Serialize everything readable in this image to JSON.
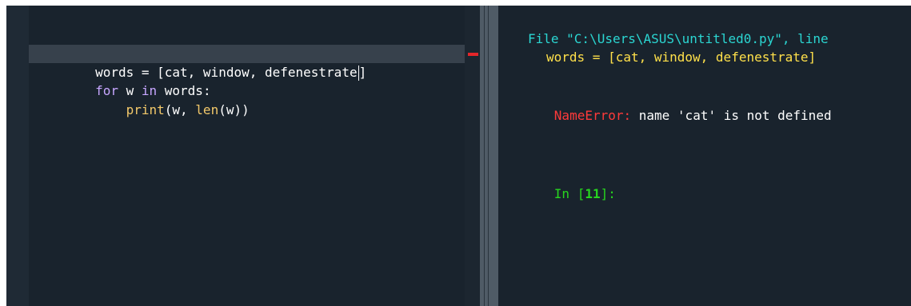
{
  "editor": {
    "lines": [
      {
        "tokens": [
          {
            "text": "words = [cat, window, defenestrate",
            "kind": "plain"
          },
          {
            "text": "]",
            "kind": "plain"
          }
        ]
      },
      {
        "tokens": [
          {
            "text": "for",
            "kind": "keyword"
          },
          {
            "text": " w ",
            "kind": "plain"
          },
          {
            "text": "in",
            "kind": "keyword"
          },
          {
            "text": " words:",
            "kind": "plain"
          }
        ]
      },
      {
        "tokens": [
          {
            "text": "    ",
            "kind": "plain"
          },
          {
            "text": "print",
            "kind": "builtin"
          },
          {
            "text": "(w, ",
            "kind": "plain"
          },
          {
            "text": "len",
            "kind": "builtin"
          },
          {
            "text": "(w))",
            "kind": "plain"
          }
        ]
      }
    ]
  },
  "console": {
    "traceback_file": "File \"C:\\Users\\ASUS\\untitled0.py\", line",
    "traceback_code": "words = [cat, window, defenestrate]",
    "error_name": "NameError:",
    "error_message": " name 'cat' is not defined",
    "prompt_prefix": "In [",
    "prompt_number": "11",
    "prompt_suffix": "]:"
  },
  "colors": {
    "editor_bg": "#19232d",
    "current_line_bg": "#37414c",
    "keyword": "#c7a6ff",
    "builtin": "#f3c96a",
    "traceback_file": "#2bd6d2",
    "traceback_code": "#ffe04a",
    "error": "#ff3a3a",
    "prompt": "#27d61e",
    "error_marker": "#e4262a"
  }
}
